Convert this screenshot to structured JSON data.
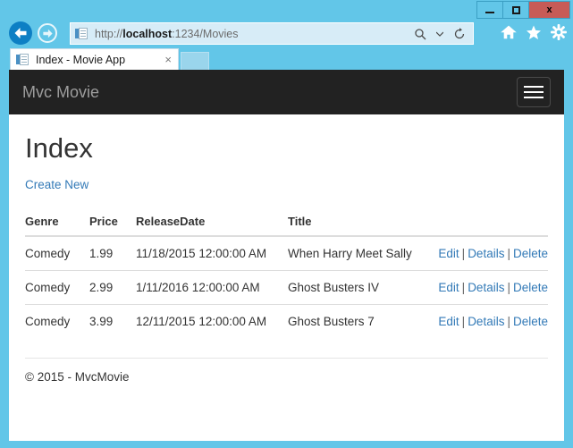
{
  "window": {
    "controls": {
      "minimize_label": "Minimize",
      "maximize_label": "Maximize",
      "close_label": "x"
    }
  },
  "browser": {
    "back_label": "Back",
    "forward_label": "Forward",
    "address": {
      "url_scheme": "http://",
      "url_host": "localhost",
      "url_rest": ":1234/Movies",
      "full_url": "http://localhost:1234/Movies",
      "search_icon": "search-icon",
      "dropdown_icon": "chevron-down-icon",
      "refresh_icon": "refresh-icon"
    },
    "toolbar": {
      "home_icon": "home-icon",
      "favorites_icon": "star-icon",
      "settings_icon": "gear-icon"
    },
    "tab": {
      "title": "Index - Movie App",
      "close_label": "×",
      "favicon": "page-icon"
    }
  },
  "page": {
    "navbar": {
      "brand": "Mvc Movie",
      "toggle_icon": "hamburger-icon"
    },
    "heading": "Index",
    "create_new_label": "Create New",
    "table": {
      "columns": [
        "Genre",
        "Price",
        "ReleaseDate",
        "Title",
        ""
      ],
      "rows": [
        {
          "genre": "Comedy",
          "price": "1.99",
          "release_date": "11/18/2015 12:00:00 AM",
          "title": "When Harry Meet Sally",
          "actions": {
            "edit": "Edit",
            "details": "Details",
            "delete": "Delete",
            "separator": "|"
          }
        },
        {
          "genre": "Comedy",
          "price": "2.99",
          "release_date": "1/11/2016 12:00:00 AM",
          "title": "Ghost Busters IV",
          "actions": {
            "edit": "Edit",
            "details": "Details",
            "delete": "Delete",
            "separator": "|"
          }
        },
        {
          "genre": "Comedy",
          "price": "3.99",
          "release_date": "12/11/2015 12:00:00 AM",
          "title": "Ghost Busters 7",
          "actions": {
            "edit": "Edit",
            "details": "Details",
            "delete": "Delete",
            "separator": "|"
          }
        }
      ]
    },
    "footer": "© 2015 - MvcMovie"
  },
  "colors": {
    "chrome_blue": "#62c6e8",
    "navbar_dark": "#222222",
    "link_blue": "#337ab7",
    "brand_gray": "#9d9d9d",
    "close_red": "#c75b57"
  }
}
